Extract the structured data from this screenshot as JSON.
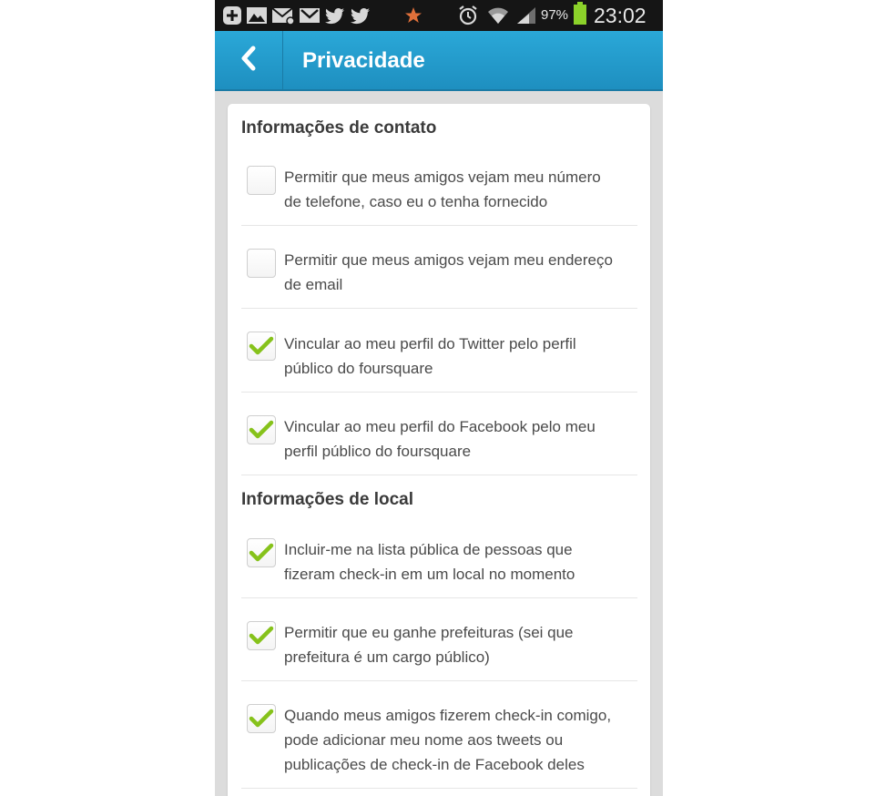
{
  "status_bar": {
    "battery_text": "97%",
    "time": "23:02",
    "icons": [
      "plus-notification-icon",
      "gallery-icon",
      "mail-icon",
      "gmail-icon",
      "twitter-icon",
      "twitter-icon",
      "star-icon",
      "alarm-icon",
      "wifi-icon",
      "signal-icon",
      "battery-icon"
    ]
  },
  "action_bar": {
    "title": "Privacidade",
    "back_icon": "chevron-left-icon"
  },
  "colors": {
    "action_bar": "#1e9bd0",
    "check": "#86c21b"
  },
  "sections": [
    {
      "title": "Informações de contato",
      "items": [
        {
          "lines": [
            "Permitir que meus amigos vejam meu número",
            "de telefone, caso eu o tenha fornecido"
          ],
          "checked": false
        },
        {
          "lines": [
            "Permitir que meus amigos vejam meu endereço",
            "de email"
          ],
          "checked": false
        },
        {
          "lines": [
            "Vincular ao meu perfil do Twitter pelo perfil",
            "público do foursquare"
          ],
          "checked": true
        },
        {
          "lines": [
            "Vincular ao meu perfil do Facebook pelo meu",
            "perfil público do foursquare"
          ],
          "checked": true
        }
      ]
    },
    {
      "title": "Informações de local",
      "items": [
        {
          "lines": [
            "Incluir-me na lista pública de pessoas que",
            "fizeram check-in em um local no momento"
          ],
          "checked": true
        },
        {
          "lines": [
            "Permitir que eu ganhe prefeituras (sei que",
            "prefeitura é um cargo público)"
          ],
          "checked": true
        },
        {
          "lines": [
            "Quando meus amigos fizerem check-in comigo,",
            "pode adicionar meu nome aos tweets ou",
            "publicações de check-in de Facebook deles"
          ],
          "checked": true
        }
      ]
    }
  ]
}
